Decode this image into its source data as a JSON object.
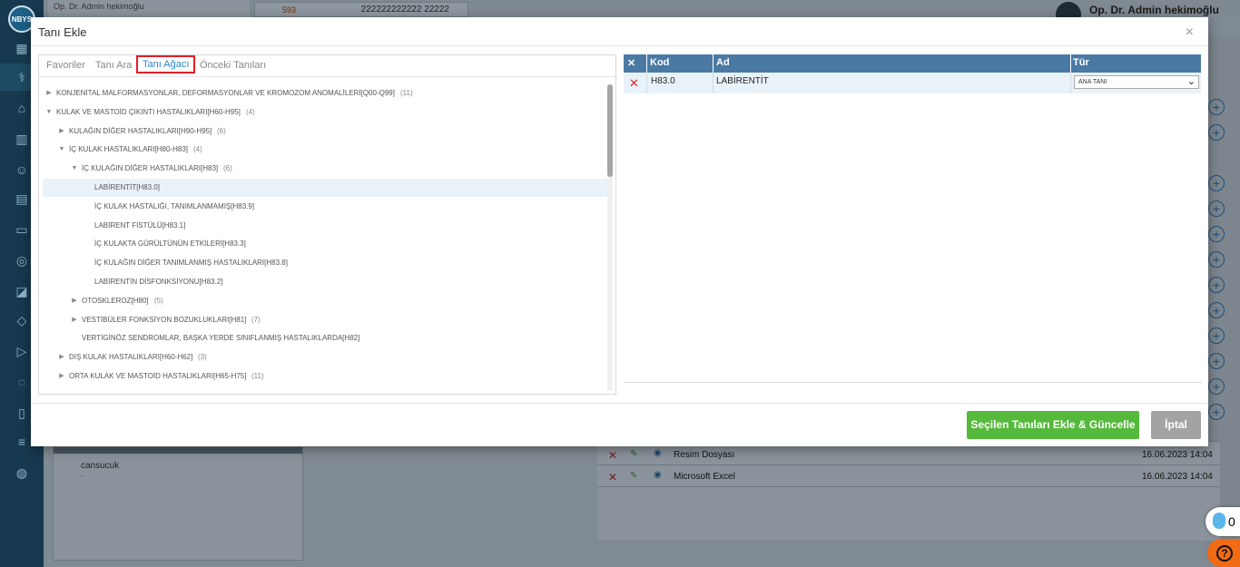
{
  "app": {
    "logo_text": "NBYS",
    "top_patient": "Op. Dr. Admin hekimoğlu",
    "top_number": "593",
    "top_id": "222222222222 22222",
    "user_name": "Op. Dr. Admin hekimoğlu"
  },
  "background": {
    "patient_card_name": "cansucuk",
    "patient_card_dash": "-",
    "files": [
      {
        "name": "Resim Dosyası",
        "date": "16.06.2023 14:04"
      },
      {
        "name": "Microsoft Excel",
        "date": "16.06.2023 14:04"
      }
    ],
    "help_count": "0",
    "help_q": "?"
  },
  "modal": {
    "title": "Tanı Ekle",
    "close": "×",
    "tabs": [
      "Favoriler",
      "Tanı Ara",
      "Tanı Ağacı",
      "Önceki Tanıları"
    ],
    "active_tab": "Tanı Ağacı",
    "tree": [
      {
        "label": "KONJENİTAL MALFORMASYONLAR, DEFORMASYONLAR VE KROMOZOM ANOMALİLERİ[Q00-Q99]",
        "count": "(11)",
        "level": 0,
        "arrow": "right"
      },
      {
        "label": "KULAK VE MASTOİD ÇIKINTI HASTALIKLARI[H60-H95]",
        "count": "(4)",
        "level": 0,
        "arrow": "down"
      },
      {
        "label": "KULAĞIN DİĞER HASTALIKLARI[H90-H95]",
        "count": "(6)",
        "level": 1,
        "arrow": "right"
      },
      {
        "label": "İÇ KULAK HASTALIKLARI[H80-H83]",
        "count": "(4)",
        "level": 1,
        "arrow": "down"
      },
      {
        "label": "İÇ KULAĞIN DİĞER HASTALIKLARI[H83]",
        "count": "(6)",
        "level": 2,
        "arrow": "down"
      },
      {
        "label": "LABİRENTİT[H83.0]",
        "count": "",
        "level": 3,
        "arrow": "",
        "selected": true
      },
      {
        "label": "İÇ KULAK HASTALIĞI, TANIMLANMAMIŞ[H83.9]",
        "count": "",
        "level": 3,
        "arrow": ""
      },
      {
        "label": "LABİRENT FİSTÜLÜ[H83.1]",
        "count": "",
        "level": 3,
        "arrow": ""
      },
      {
        "label": "İÇ KULAKTA GÜRÜLTÜNÜN ETKİLERİ[H83.3]",
        "count": "",
        "level": 3,
        "arrow": ""
      },
      {
        "label": "İÇ KULAĞIN DİĞER TANIMLANMIŞ HASTALIKLARI[H83.8]",
        "count": "",
        "level": 3,
        "arrow": ""
      },
      {
        "label": "LABİRENTİN DİSFONKSİYONU[H83.2]",
        "count": "",
        "level": 3,
        "arrow": ""
      },
      {
        "label": "OTOSKLEROZ[H80]",
        "count": "(5)",
        "level": 2,
        "arrow": "right"
      },
      {
        "label": "VESTİBÜLER FONKSİYON BOZUKLUKLARI[H81]",
        "count": "(7)",
        "level": 2,
        "arrow": "right"
      },
      {
        "label": "VERTİGİNÖZ SENDROMLAR, BAŞKA YERDE SINIFLANMIŞ HASTALIKLARDA[H82]",
        "count": "",
        "level": 2,
        "arrow": ""
      },
      {
        "label": "DIŞ KULAK HASTALIKLARI[H60-H62]",
        "count": "(3)",
        "level": 1,
        "arrow": "right"
      },
      {
        "label": "ORTA KULAK VE MASTOİD HASTALIKLARI[H65-H75]",
        "count": "(11)",
        "level": 1,
        "arrow": "right"
      }
    ],
    "grid": {
      "headers": {
        "x": "✕",
        "kod": "Kod",
        "ad": "Ad",
        "tur": "Tür"
      },
      "rows": [
        {
          "kod": "H83.0",
          "ad": "LABİRENTİT",
          "tur": "ANA TANI"
        }
      ]
    },
    "buttons": {
      "save": "Seçilen Tanıları Ekle & Güncelle",
      "cancel": "İptal"
    }
  }
}
